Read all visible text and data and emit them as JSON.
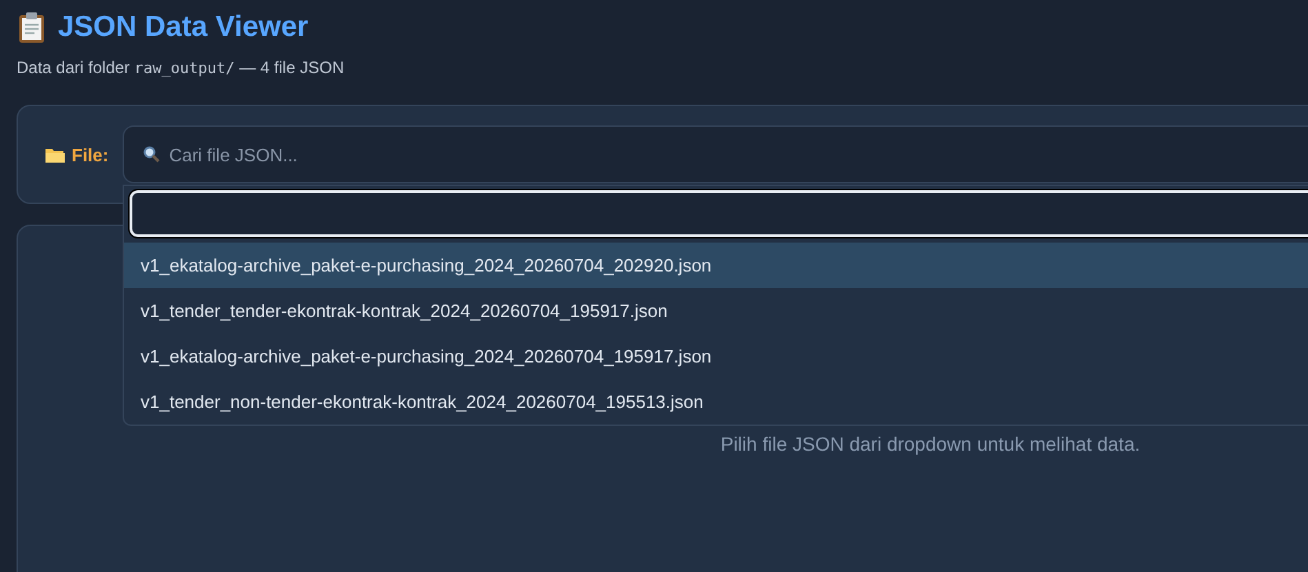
{
  "header": {
    "title": "JSON Data Viewer",
    "subtitle": {
      "before": "Data dari folder ",
      "code": "raw_output/",
      "after": " — 4 file JSON"
    }
  },
  "file_picker": {
    "label": "File:",
    "placeholder": "Cari file JSON...",
    "dropdown": {
      "options": [
        {
          "label": "v1_ekatalog-archive_paket-e-purchasing_2024_20260704_202920.json",
          "selected": true
        },
        {
          "label": "v1_tender_tender-ekontrak-kontrak_2024_20260704_195917.json",
          "selected": false
        },
        {
          "label": "v1_ekatalog-archive_paket-e-purchasing_2024_20260704_195917.json",
          "selected": false
        },
        {
          "label": "v1_tender_non-tender-ekontrak-kontrak_2024_20260704_195513.json",
          "selected": false
        }
      ]
    }
  },
  "content": {
    "empty_message": "Pilih file JSON dari dropdown untuk melihat data."
  }
}
